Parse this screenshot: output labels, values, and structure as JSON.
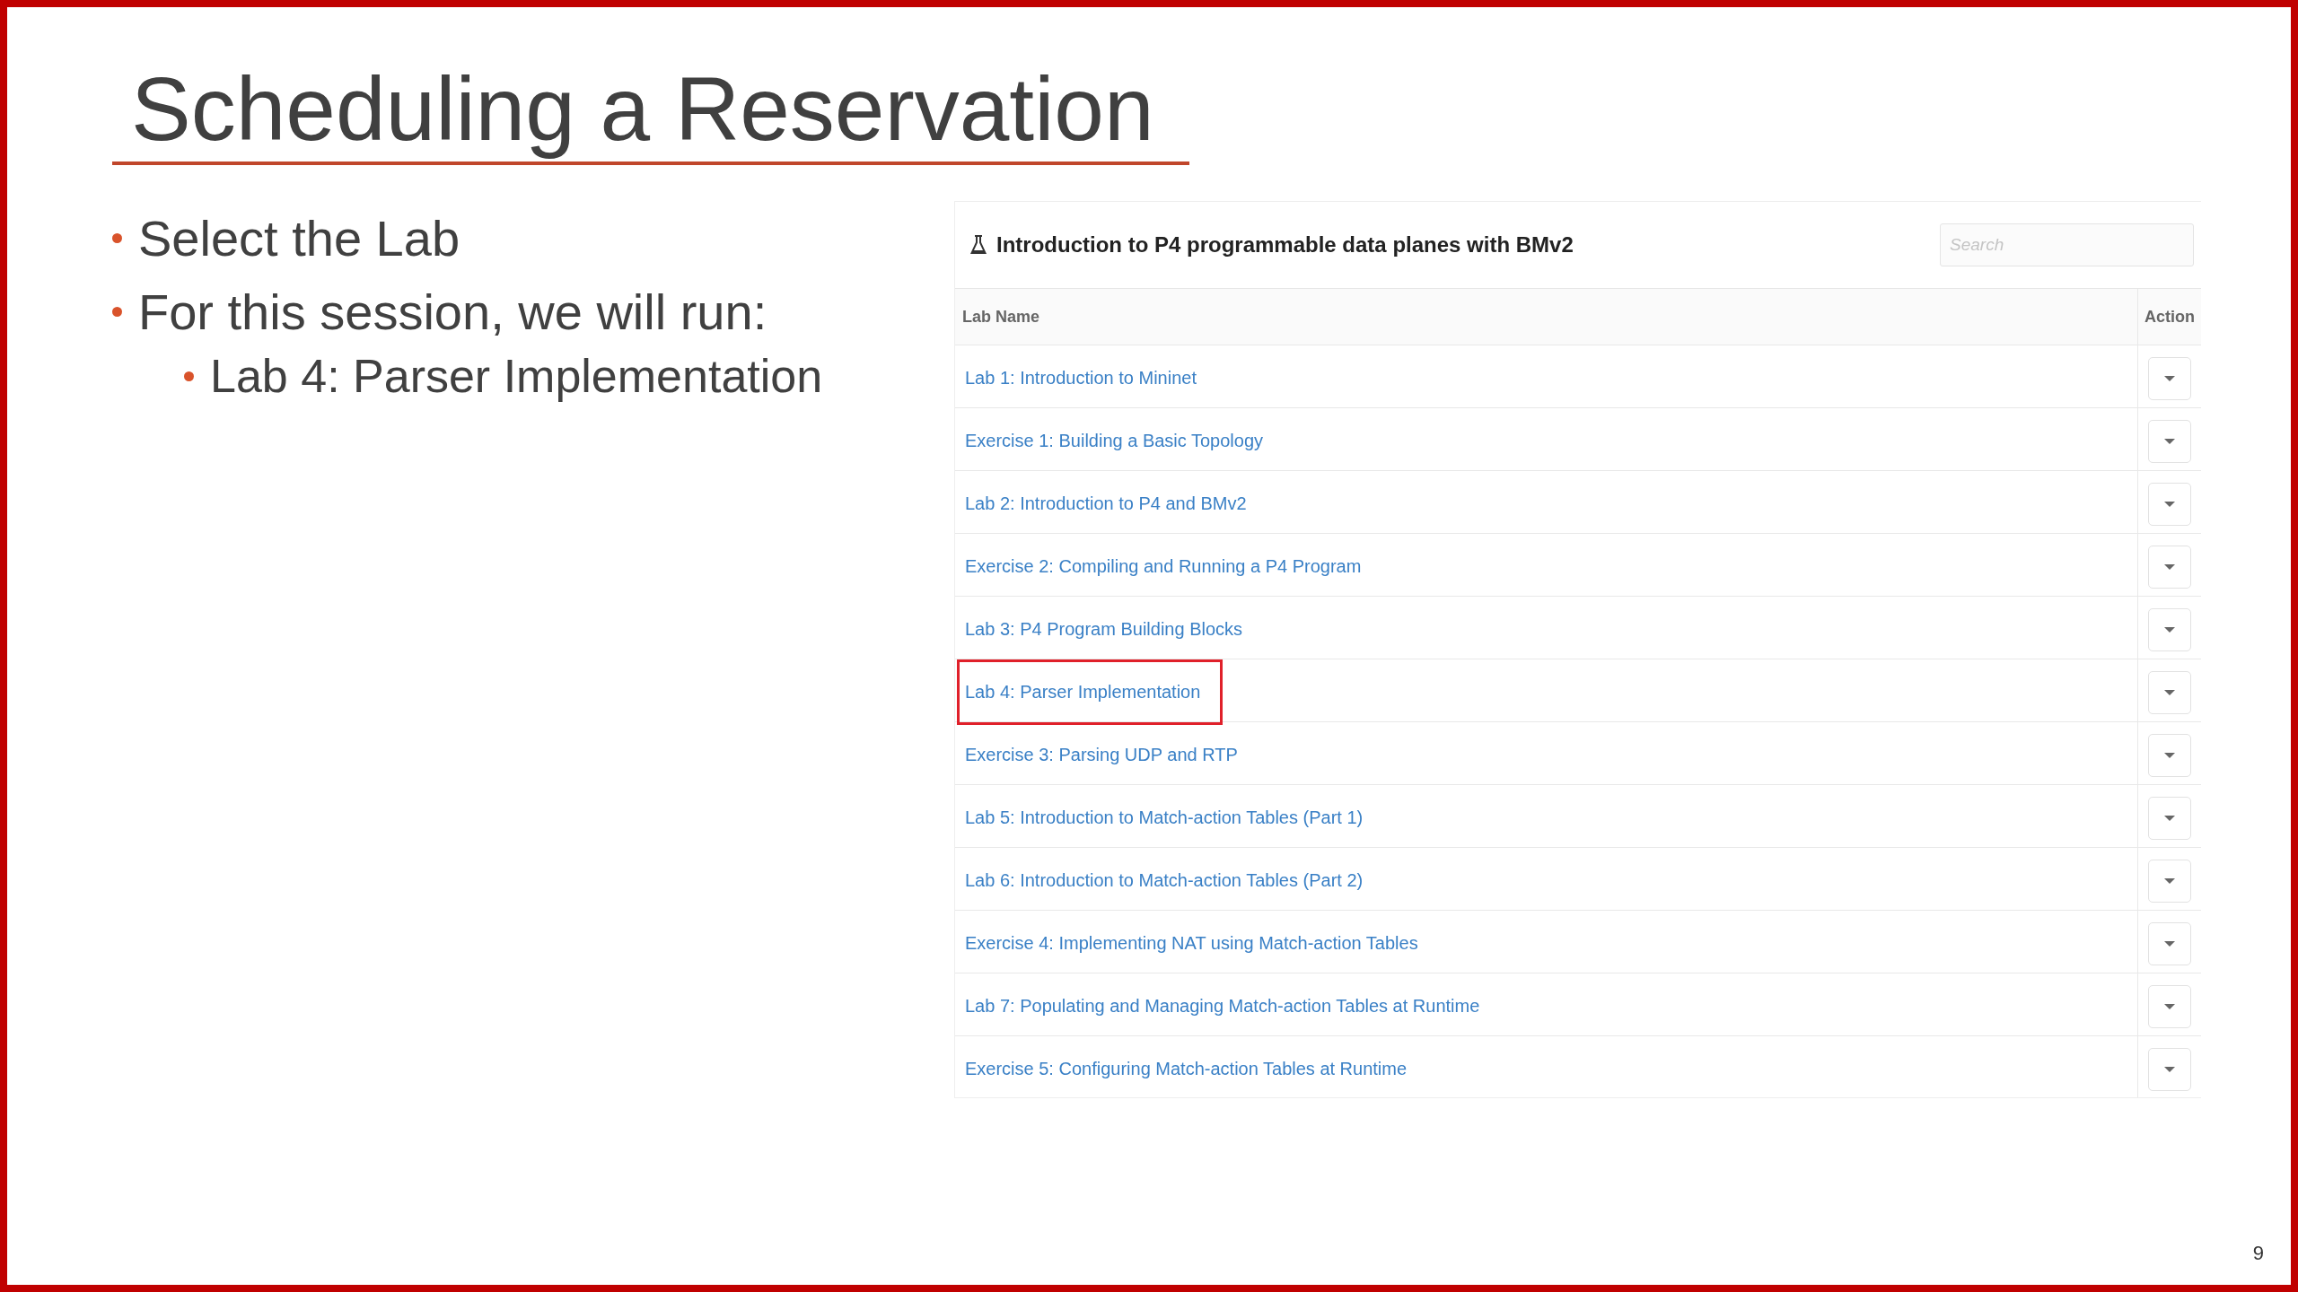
{
  "slide": {
    "title": "Scheduling a Reservation",
    "bullets": [
      {
        "text": "Select the Lab"
      },
      {
        "text": "For this session, we will run:",
        "children": [
          {
            "text": "Lab 4: Parser Implementation"
          }
        ]
      }
    ],
    "page_number": "9"
  },
  "panel": {
    "title": "Introduction to P4 programmable data planes with BMv2",
    "search": {
      "placeholder": "Search"
    },
    "columns": [
      "Lab Name",
      "Action"
    ],
    "rows": [
      {
        "name": "Lab 1: Introduction to Mininet",
        "highlighted": false
      },
      {
        "name": "Exercise 1: Building a Basic Topology",
        "highlighted": false
      },
      {
        "name": "Lab 2: Introduction to P4 and BMv2",
        "highlighted": false
      },
      {
        "name": "Exercise 2: Compiling and Running a P4 Program",
        "highlighted": false
      },
      {
        "name": "Lab 3: P4 Program Building Blocks",
        "highlighted": false
      },
      {
        "name": "Lab 4: Parser Implementation",
        "highlighted": true
      },
      {
        "name": "Exercise 3: Parsing UDP and RTP",
        "highlighted": false
      },
      {
        "name": "Lab 5: Introduction to Match-action Tables (Part 1)",
        "highlighted": false
      },
      {
        "name": "Lab 6: Introduction to Match-action Tables (Part 2)",
        "highlighted": false
      },
      {
        "name": "Exercise 4: Implementing NAT using Match-action Tables",
        "highlighted": false
      },
      {
        "name": "Lab 7: Populating and Managing Match-action Tables at Runtime",
        "highlighted": false
      },
      {
        "name": "Exercise 5: Configuring Match-action Tables at Runtime",
        "highlighted": false
      }
    ]
  }
}
